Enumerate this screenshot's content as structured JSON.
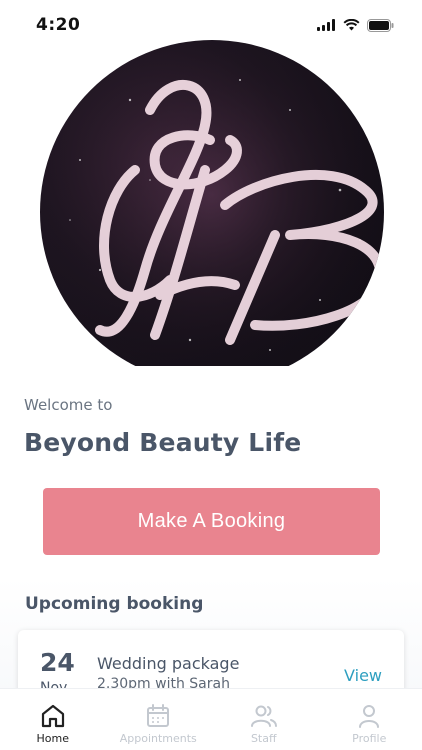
{
  "status_bar": {
    "time": "4:20"
  },
  "logo": {
    "icon": "beyond-beauty-monogram"
  },
  "welcome": {
    "label": "Welcome to",
    "business_name": "Beyond Beauty Life"
  },
  "actions": {
    "book_label": "Make A Booking"
  },
  "upcoming": {
    "title": "Upcoming booking",
    "booking": {
      "day": "24",
      "month": "Nov",
      "title": "Wedding package",
      "subtitle": "2.30pm with Sarah",
      "view_label": "View"
    }
  },
  "tabs": [
    {
      "label": "Home",
      "icon": "home-icon",
      "active": true
    },
    {
      "label": "Appointments",
      "icon": "calendar-icon",
      "active": false
    },
    {
      "label": "Staff",
      "icon": "users-icon",
      "active": false
    },
    {
      "label": "Profile",
      "icon": "user-icon",
      "active": false
    }
  ],
  "colors": {
    "accent": "#e9848f",
    "link": "#2e9fc0",
    "heading": "#4a5668",
    "inactive": "#c3c8cf"
  }
}
